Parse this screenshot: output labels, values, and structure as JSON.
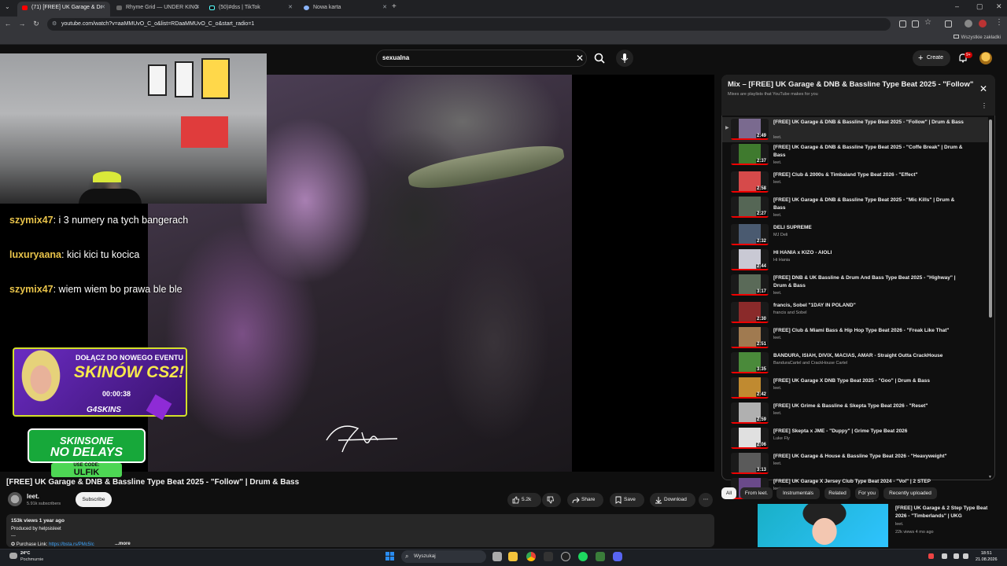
{
  "browser": {
    "tabs": [
      {
        "label": "(71) [FREE] UK Garage & Dr",
        "active": true,
        "icon": "youtube-icon"
      },
      {
        "label": "Rhyme Grid — UNDER KING",
        "active": false,
        "icon": "rhyme-icon"
      },
      {
        "label": "(50)#dss | TikTok",
        "active": false,
        "icon": "tiktok-icon"
      },
      {
        "label": "Nowa karta",
        "active": false,
        "icon": "globe-icon"
      }
    ],
    "new_tab": "+",
    "url": "youtube.com/watch?v=aaMMUvO_C_o&list=RDaaMMUvO_C_o&start_radio=1",
    "bookmarks_label": "Wszystkie zakładki"
  },
  "header": {
    "search_query": "sexualna",
    "create_label": "Create",
    "notifications": "9+"
  },
  "overlay": {
    "chat": [
      {
        "user": "szymix47",
        "msg": ": i 3 numery na tych bangerach"
      },
      {
        "user": "luxuryaana",
        "msg": ": kici kici tu kocica"
      },
      {
        "user": "szymix47",
        "msg": ": wiem wiem bo prawa ble ble"
      }
    ],
    "promo1": {
      "line1": "DOŁĄCZ DO NOWEGO EVENTU",
      "line2": "SKINÓW CS2!",
      "timer": "00:00:38",
      "brand": "G4SKINS"
    },
    "promo2": {
      "line1": "SKINSONE",
      "line2": "NO DELAYS",
      "code_label": "USE CODE:",
      "code": "ULFIK"
    }
  },
  "video": {
    "title": "[FREE] UK Garage & DNB & Bassline Type Beat 2025 - \"Follow\" | Drum & Bass",
    "channel": "leet.",
    "subscribers": "5.91k subscribers",
    "subscribe_label": "Subscribe",
    "likes": "5.2k",
    "share_label": "Share",
    "save_label": "Save",
    "download_label": "Download",
    "views_date": "153k views  1 year ago",
    "produced_by": "Produced by helpsisleet",
    "separator": "---",
    "purchase_label": "Purchase Link: ",
    "purchase_link": "https://bsta.rs/PMc5Ic",
    "more_label": "...more"
  },
  "playlist": {
    "title": "Mix – [FREE] UK Garage & DNB & Bassline Type Beat 2025 - \"Follow\" | Drum & Bass",
    "subtitle": "Mixes are playlists that YouTube makes for you",
    "items": [
      {
        "title": "[FREE] UK Garage & DNB & Bassline Type Beat 2025 - \"Follow\" | Drum & Bass",
        "channel": "leet.",
        "duration": "2:49",
        "color": "#7a6a8f"
      },
      {
        "title": "[FREE] UK Garage & DNB & Bassline Type Beat 2025 - \"Coffe Break\" | Drum & Bass",
        "channel": "leet.",
        "duration": "2:37",
        "color": "#3f7a2e"
      },
      {
        "title": "[FREE] Club & 2000s & Timbaland Type Beat 2026 - \"Effect\"",
        "channel": "leet.",
        "duration": "2:58",
        "color": "#d64a4a"
      },
      {
        "title": "[FREE] UK Garage & DNB & Bassline Type Beat 2025 - \"Mic Kills\" | Drum & Bass",
        "channel": "leet.",
        "duration": "2:27",
        "color": "#556655"
      },
      {
        "title": "DELI SUPREME",
        "channel": "MJ Deli",
        "duration": "2:32",
        "color": "#4a5a70"
      },
      {
        "title": "HI HANIA x KIZO - AIOLI",
        "channel": "Hi Hania",
        "duration": "2:44",
        "color": "#c9c9d4"
      },
      {
        "title": "[FREE] DNB & UK Bassline & Drum And Bass Type Beat 2025 - \"Highway\" | Drum & Bass",
        "channel": "leet.",
        "duration": "3:17",
        "color": "#5a6a58"
      },
      {
        "title": "francis, Sobel \"1DAY IN POLAND\"",
        "channel": "francis and Sobel",
        "duration": "2:30",
        "color": "#8a2a2a"
      },
      {
        "title": "[FREE] Club & Miami Bass & Hip Hop Type Beat 2026 - \"Freak Like That\"",
        "channel": "leet.",
        "duration": "2:51",
        "color": "#a07a50"
      },
      {
        "title": "BANDURA, ISIAH, DIVIX, MACIAS, AMAR - Straight Outta CrackHouse",
        "channel": "BanduraCartel and CrackHouse Cartel",
        "duration": "3:35",
        "color": "#4a8a3a"
      },
      {
        "title": "[FREE] UK Garage X DNB Type Beat 2025 - \"Goo\" | Drum & Bass",
        "channel": "leet.",
        "duration": "2:42",
        "color": "#c08a30"
      },
      {
        "title": "[FREE] UK Grime & Bassline & Skepta Type Beat 2026 - \"Reset\"",
        "channel": "leet.",
        "duration": "2:59",
        "color": "#b0b0b0"
      },
      {
        "title": "[FREE] Skepta x JME - \"Duppy\" | Grime Type Beat 2026",
        "channel": "Luke Fly",
        "duration": "2:06",
        "color": "#e0e0e0"
      },
      {
        "title": "[FREE] UK Garage & House & Bassline Type Beat 2026 - \"Heavyweight\"",
        "channel": "leet.",
        "duration": "3:13",
        "color": "#5a5a5a"
      },
      {
        "title": "[FREE] UK Garage X Jersey Club Type Beat 2024 - \"Vol\" | 2 STEP",
        "channel": "leet.",
        "duration": "2:40",
        "color": "#6a4a8a"
      }
    ]
  },
  "chips": [
    "All",
    "From leet.",
    "Instrumentals",
    "Related",
    "For you",
    "Recently uploaded"
  ],
  "related": {
    "title": "[FREE] UK Garage & 2 Step Type Beat 2026 - \"Timberlands\" | UKG",
    "channel": "leet.",
    "views": "22k views  4 mo ago"
  },
  "taskbar": {
    "temp": "24°C",
    "weather": "Pochmurnie",
    "search_placeholder": "Wyszukaj",
    "time": "18:51",
    "date": "21.08.2026"
  }
}
